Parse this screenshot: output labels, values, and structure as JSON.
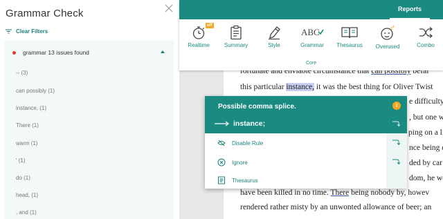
{
  "panel": {
    "title": "Grammar Check",
    "clear_filters": "Clear Filters"
  },
  "issues": {
    "header": "grammar 13 issues found",
    "items": [
      "-- (3)",
      "can possibly (1)",
      "instance, (1)",
      "There (1)",
      "warm (1)",
      "' (1)",
      "do (1)",
      "head, (1)",
      ", and (1)"
    ]
  },
  "toolbar": {
    "reports_tab": "Reports",
    "off_badge": "off",
    "tools": [
      {
        "label": "Realtime",
        "icon": "stopwatch-icon"
      },
      {
        "label": "Summary",
        "icon": "clipboard-icon"
      },
      {
        "label": "Style",
        "icon": "pen-icon"
      },
      {
        "label": "Grammar",
        "icon": "abc-check-icon"
      },
      {
        "label": "Thesaurus",
        "icon": "book-icon"
      },
      {
        "label": "Overused",
        "icon": "sleepy-face-icon"
      },
      {
        "label": "Combo",
        "icon": "shuffle-icon"
      }
    ],
    "core_label": "Core"
  },
  "document": {
    "line1": {
      "pre": "fortunate and enviable circumstance that ",
      "u": "can possibly",
      "post": " befal"
    },
    "line2": {
      "pre": "this particular ",
      "hl": "instance,",
      "post": " it was the best thing for Oliver Twist"
    },
    "line3": "e difficulty",
    "line4": ", but one w",
    "line5": "ping on a li",
    "line6": "nce being d",
    "line7": "ded by car",
    "line8": "dom, he wo",
    "line9": {
      "pre": "have been killed in no time. ",
      "u": "There",
      "post": " being nobody by, howev"
    },
    "line10": "rendered rather misty by an unwonted allowance of beer; an"
  },
  "popup": {
    "title": "Possible comma splice.",
    "info": "i",
    "suggestion": "instance;",
    "actions": [
      {
        "label": "Disable Rule",
        "icon": "eye-off-icon"
      },
      {
        "label": "Ignore",
        "icon": "x-circle-icon"
      },
      {
        "label": "Thesaurus",
        "icon": "thesaurus-icon"
      }
    ]
  },
  "colors": {
    "accent": "#1b8a80",
    "badge": "#f5a623",
    "issue_dot": "#e53935",
    "highlight": "#c9cdf0"
  }
}
